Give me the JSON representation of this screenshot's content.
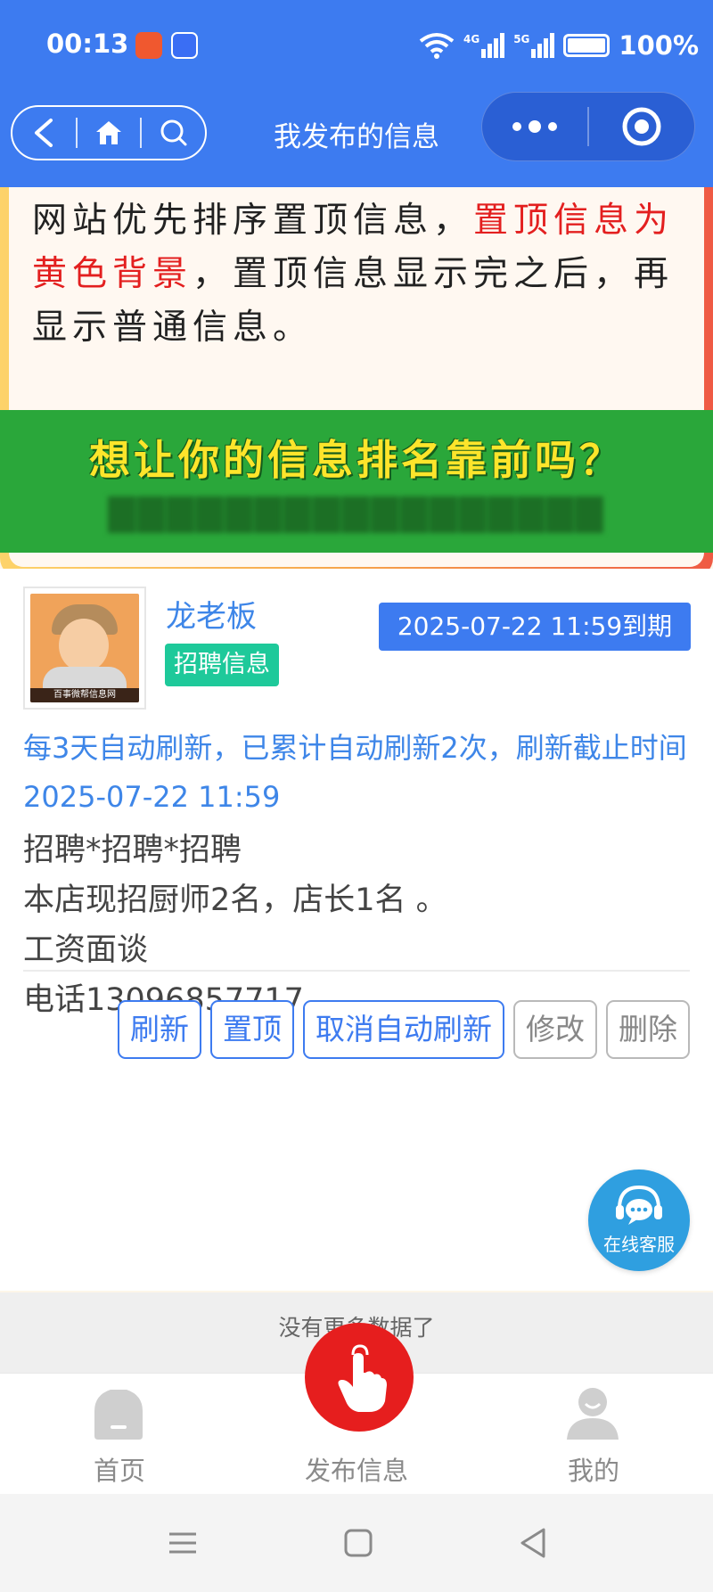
{
  "status_bar": {
    "time": "00:13",
    "network_4g": "4G",
    "network_5g": "5G",
    "battery": "100%"
  },
  "nav": {
    "title": "我发布的信息",
    "icons": [
      "back-icon",
      "home-icon",
      "search-icon",
      "more-icon",
      "target-icon"
    ]
  },
  "notice": {
    "text_1": "网站优先排序置顶信息，",
    "text_red": "置顶信息为黄色背景",
    "text_2": "，置顶信息显示完之后，再显示普通信息。"
  },
  "banner": {
    "title": "想让你的信息排名靠前吗？"
  },
  "post": {
    "avatar_caption": "百事微帮信息网",
    "author": "龙老板",
    "category": "招聘信息",
    "expires": "2025-07-22 11:59到期",
    "refresh_info": "每3天自动刷新，已累计自动刷新2次，刷新截止时间2025-07-22 11:59",
    "lines": [
      "招聘*招聘*招聘",
      "本店现招厨师2名，店长1名 。",
      "工资面谈",
      "电话13096857717"
    ],
    "buttons": {
      "refresh": "刷新",
      "pin": "置顶",
      "cancel_auto": "取消自动刷新",
      "edit": "修改",
      "delete": "删除"
    }
  },
  "customer_service": "在线客服",
  "no_more": "没有更多数据了",
  "tabbar": {
    "home": "首页",
    "post": "发布信息",
    "mine": "我的"
  },
  "colors": {
    "primary": "#3d7bf0",
    "banner_green": "#2aa73a",
    "badge_green": "#1ec99a",
    "fab_red": "#e61e1e",
    "highlight_red": "#e31f1f"
  }
}
